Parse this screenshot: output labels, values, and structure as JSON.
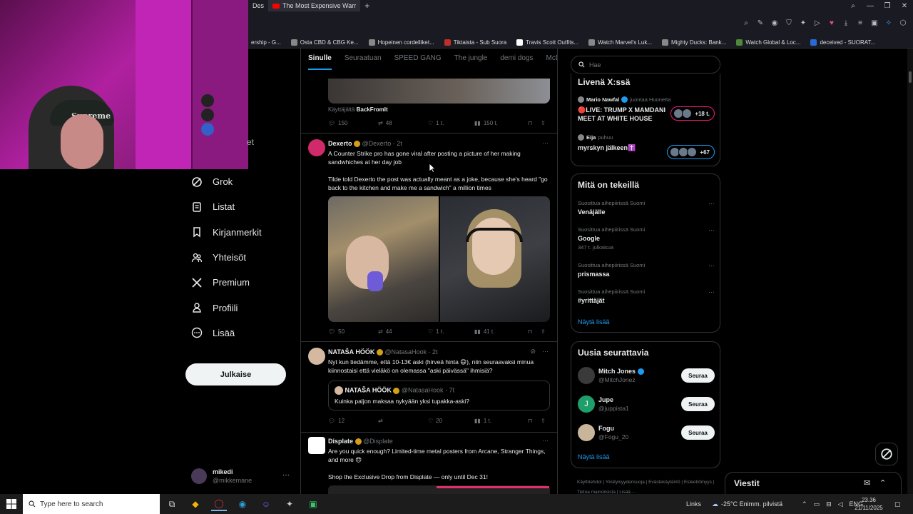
{
  "browser": {
    "tabs": [
      {
        "label": "Des",
        "active": false
      },
      {
        "label": "The Most Expensive Warr",
        "active": true
      }
    ],
    "bookmarks": [
      "ership - G...",
      "Osta CBD & CBG Ke...",
      "Hopeinen cordelliket...",
      "Tiktaista - Sub Suora",
      "Travis Scott Outfits...",
      "Watch Marvel's Luk...",
      "Mighty Ducks: Bank...",
      "Watch Global & Loc...",
      "deceived - SUORAT..."
    ]
  },
  "webcam": {
    "cap_text": "Supreme"
  },
  "nav": {
    "partial": "et",
    "items": [
      {
        "label": "Grok",
        "icon": "grok-icon"
      },
      {
        "label": "Listat",
        "icon": "list-icon"
      },
      {
        "label": "Kirjanmerkit",
        "icon": "bookmark-icon"
      },
      {
        "label": "Yhteisöt",
        "icon": "communities-icon"
      },
      {
        "label": "Premium",
        "icon": "x-logo-icon"
      },
      {
        "label": "Profiili",
        "icon": "profile-icon"
      },
      {
        "label": "Lisää",
        "icon": "more-circle-icon"
      }
    ],
    "post_button": "Julkaise",
    "account": {
      "name": "mikedi",
      "handle": "@mikkemane"
    }
  },
  "feed": {
    "tabs": [
      "Sinulle",
      "Seuraatuan",
      "SPEED GANG",
      "The jungle",
      "demi dogs",
      "McDonald"
    ],
    "active_tab": "Sinulle",
    "prev_post": {
      "via_prefix": "Käyttäjältä",
      "via_user": "BackFromIt",
      "replies": "150",
      "reposts": "48",
      "likes": "1 t.",
      "views": "150 t."
    },
    "posts": [
      {
        "name": "Dexerto",
        "handle": "@Dexerto",
        "time": "2t",
        "text1": "A Counter Strike pro has gone viral after posting a picture of her making sandwhiches at her day job",
        "text2": "Tilde told Dexerto the post was actually meant as a joke, because she's heard \"go back to the kitchen and make me a sandwich\" a million times",
        "replies": "50",
        "reposts": "44",
        "likes": "1 t.",
        "views": "41 t."
      },
      {
        "name": "NATAŠA HÖÖK",
        "handle": "@NatasaHook",
        "time": "2t",
        "text1": "Nyt kun tiedämme, että 10-13€ aski (hirveä hinta 😄), niin seuraavaksi minua kiinnostaisi että vieläkö on olemassa \"aski päivässä\" ihmisiä?",
        "quote": {
          "name": "NATAŠA HÖÖK",
          "handle": "@NatasaHook",
          "time": "7t",
          "text": "Kuinka paljon maksaa nykyään yksi tupakka-aski?"
        },
        "replies": "12",
        "reposts": "",
        "likes": "20",
        "views": "1 t."
      },
      {
        "name": "Displate",
        "handle": "@Displate",
        "text1": "Are you quick enough? Limited-time metal posters from Arcane, Stranger Things, and more 😍",
        "text2": "Shop the Exclusive Drop from Displate — only until Dec 31!"
      }
    ]
  },
  "right": {
    "search_placeholder": "Hae",
    "live": {
      "title": "Livenä X:ssä",
      "rows": [
        {
          "host": "Mario Nawfal",
          "context": "juontaa Huonetta",
          "title": "🔴LIVE: TRUMP  X MAMDANI MEET AT WHITE HOUSE",
          "count": "+18 t."
        },
        {
          "host": "Eija",
          "context": "puhuu",
          "title": "myrskyn jälkeen✝️",
          "count": "+67"
        }
      ]
    },
    "trends": {
      "title": "Mitä on tekeillä",
      "items": [
        {
          "context": "Suosittua aihepiirissä Suomi",
          "name": "Venäjälle",
          "count": ""
        },
        {
          "context": "Suosittua aihepiirissä Suomi",
          "name": "Google",
          "count": "347 t. julkaisua"
        },
        {
          "context": "Suosittua aihepiirissä Suomi",
          "name": "prismassa",
          "count": ""
        },
        {
          "context": "Suosittua aihepiirissä Suomi",
          "name": "#yrittäjät",
          "count": ""
        }
      ],
      "show_more": "Näytä lisää"
    },
    "who_to_follow": {
      "title": "Uusia seurattavia",
      "items": [
        {
          "name": "Mitch Jones",
          "handle": "@MitchJonez",
          "button": "Seuraa",
          "avatar_color": "#3a3a3a"
        },
        {
          "name": "Jupe",
          "handle": "@juppista1",
          "button": "Seuraa",
          "avatar_color": "#1e9e6a",
          "initial": "J"
        },
        {
          "name": "Fogu",
          "handle": "@Fogu_20",
          "button": "Seuraa",
          "avatar_color": "#c8b59a"
        }
      ],
      "show_more": "Näytä lisää"
    },
    "footer": [
      "Käyttöehdot",
      "Yksityisyydensuoja",
      "Evästekäytäntö",
      "Esteettömyys",
      "Tietoa mainoksista",
      "Lisää ···"
    ],
    "messages_title": "Viestit"
  },
  "taskbar": {
    "search_placeholder": "Type here to search",
    "links_label": "Links",
    "weather": "-25°C  Enimm. pilvistä",
    "language": "ENG",
    "time": "23.36",
    "date": "21/11/2025"
  }
}
